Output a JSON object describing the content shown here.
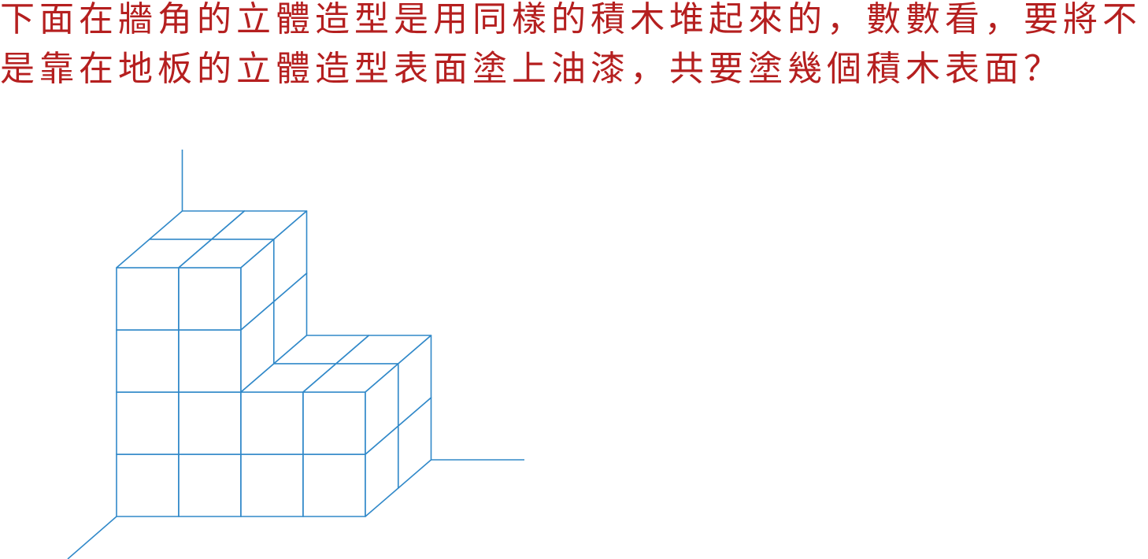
{
  "question": {
    "line1": "下面在牆角的立體造型是用同樣的積木堆起來的，數數看，要將不",
    "line2": "是靠在地板的立體造型表面塗上油漆，共要塗幾個積木表面？"
  },
  "figure": {
    "cube_heights_front_to_back": [
      [
        4,
        4,
        2,
        2
      ],
      [
        4,
        4,
        2,
        2
      ]
    ]
  },
  "colors": {
    "text": "#b51f1f",
    "line": "#3189c9",
    "face_fill": "#ffffff",
    "background": "#ffffff"
  }
}
